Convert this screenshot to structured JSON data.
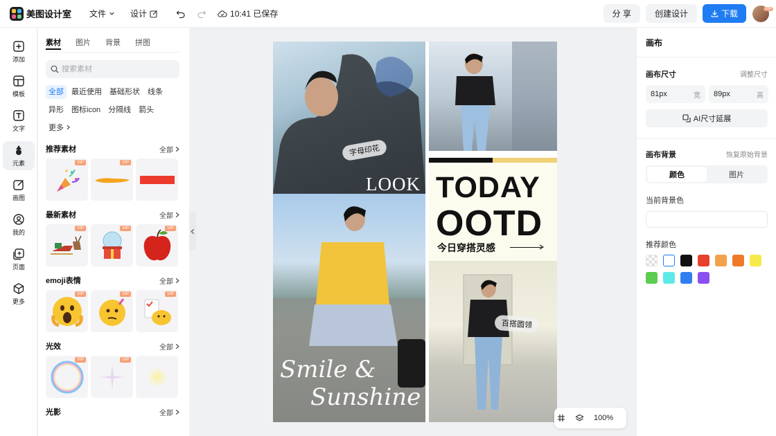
{
  "app": {
    "name": "美图设计室"
  },
  "topbar": {
    "file_menu": "文件",
    "design_menu": "设计",
    "save_status": "10:41 已保存",
    "share_label": "分 享",
    "create_label": "创建设计",
    "download_label": "下载",
    "avatar_badge": "VIP"
  },
  "rail": {
    "items": [
      {
        "label": "添加",
        "icon": "plus-square-icon"
      },
      {
        "label": "模板",
        "icon": "template-icon"
      },
      {
        "label": "文字",
        "icon": "text-icon"
      },
      {
        "label": "元素",
        "icon": "shapes-icon"
      },
      {
        "label": "画图",
        "icon": "pen-icon"
      },
      {
        "label": "我的",
        "icon": "user-icon"
      },
      {
        "label": "页面",
        "icon": "page-icon"
      },
      {
        "label": "更多",
        "icon": "cube-icon"
      }
    ],
    "active_index": 3
  },
  "assets": {
    "tabs": [
      "素材",
      "图片",
      "背景",
      "拼图"
    ],
    "search_placeholder": "搜索素材",
    "chips": [
      "全部",
      "最近使用",
      "基础形状",
      "线条",
      "异形",
      "图标icon",
      "分隔线",
      "箭头",
      "更多"
    ],
    "vip_label": "VIP",
    "all_label": "全部",
    "sections": [
      {
        "title": "推荐素材"
      },
      {
        "title": "最新素材"
      },
      {
        "title": "emoji表情"
      },
      {
        "title": "光效"
      },
      {
        "title": "光影"
      }
    ]
  },
  "canvas": {
    "pill1": "字母印花",
    "look_text": "LOOK",
    "today": "TODAY",
    "ootd": "OOTD",
    "subtitle": "今日穿搭灵感",
    "pill2": "百搭圆领",
    "script1": "Smile &",
    "script2": "Sunshine"
  },
  "zoom": {
    "level": "100%"
  },
  "right_panel": {
    "title": "画布",
    "size_label": "画布尺寸",
    "adjust_link": "调整尺寸",
    "width_value": "81px",
    "width_unit": "宽",
    "height_value": "89px",
    "height_unit": "高",
    "ai_button": "AI尺寸延展",
    "bg_label": "画布背景",
    "reset_link": "恢复原始背景",
    "seg_color": "颜色",
    "seg_image": "图片",
    "current_bg_label": "当前背景色",
    "recommend_label": "推荐颜色",
    "swatches": [
      "transparent",
      "#ffffff",
      "#111111",
      "#e8412c",
      "#f2a24c",
      "#ef7a2a",
      "#f7e94a",
      "#5ccd4e",
      "#5ee9e8",
      "#2f7ff0",
      "#8a4ff0"
    ]
  }
}
